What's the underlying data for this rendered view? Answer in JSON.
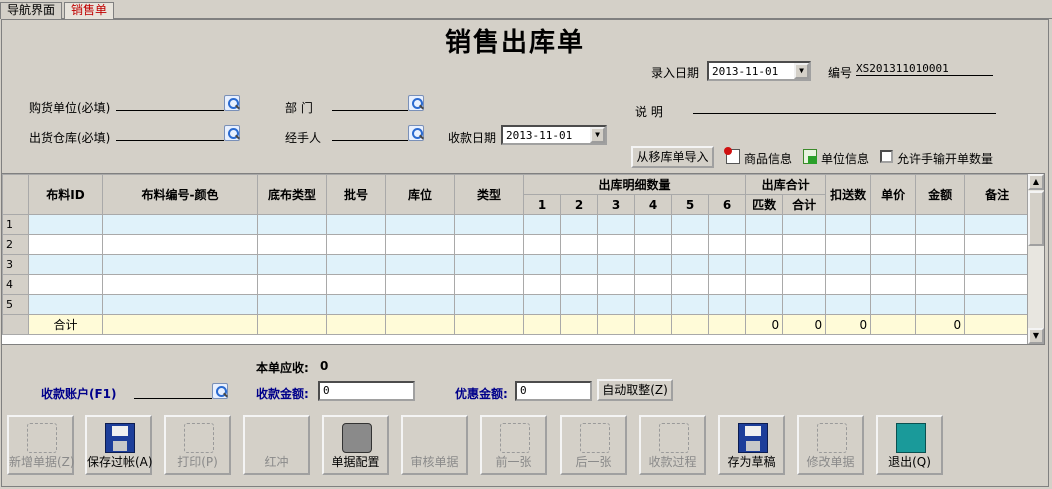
{
  "tabs": [
    {
      "label": "导航界面"
    },
    {
      "label": "销售单"
    }
  ],
  "title": "销售出库单",
  "header": {
    "entry_date_label": "录入日期",
    "entry_date_value": "2013-11-01",
    "number_label": "编号",
    "number_value": "XS201311010001",
    "buyer_label": "购货单位(必填)",
    "dept_label": "部  门",
    "remark_label": "说    明",
    "warehouse_label": "出货仓库(必填)",
    "handler_label": "经手人",
    "collect_date_label": "收款日期",
    "collect_date_value": "2013-11-01",
    "import_button": "从移库单导入",
    "goods_info": "商品信息",
    "unit_info": "单位信息",
    "allow_manual": "允许手输开单数量"
  },
  "grid": {
    "headers": {
      "fabric_id": "布料ID",
      "fabric_code": "布料编号-颜色",
      "base_type": "底布类型",
      "batch": "批号",
      "location": "库位",
      "type": "类型",
      "detail_group": "出库明细数量",
      "detail_cols": [
        "1",
        "2",
        "3",
        "4",
        "5",
        "6"
      ],
      "total_group": "出库合计",
      "pieces": "匹数",
      "total": "合计",
      "deduct": "扣送数",
      "price": "单价",
      "amount": "金额",
      "note": "备注"
    },
    "row_numbers": [
      "1",
      "2",
      "3",
      "4",
      "5"
    ],
    "sum_row": {
      "label": "合计",
      "pieces": "0",
      "total": "0",
      "deduct": "0",
      "amount": "0"
    }
  },
  "footer": {
    "receivable_label": "本单应收:",
    "receivable_value": "0",
    "account_label": "收款账户(F1)",
    "amount_label": "收款金额:",
    "amount_value": "0",
    "discount_label": "优惠金额:",
    "discount_value": "0",
    "auto_round": "自动取整(Z)"
  },
  "toolbar": [
    {
      "label": "新增单据(Z)",
      "icon": "new-document-icon",
      "enabled": false
    },
    {
      "label": "保存过帐(A)",
      "icon": "save-icon",
      "enabled": true
    },
    {
      "label": "打印(P)",
      "icon": "print-icon",
      "enabled": false
    },
    {
      "label": "红冲",
      "icon": "",
      "enabled": false
    },
    {
      "label": "单据配置",
      "icon": "config-icon",
      "enabled": true
    },
    {
      "label": "审核单据",
      "icon": "",
      "enabled": false
    },
    {
      "label": "前一张",
      "icon": "prev-hand-icon",
      "enabled": false
    },
    {
      "label": "后一张",
      "icon": "next-hand-icon",
      "enabled": false
    },
    {
      "label": "收款过程",
      "icon": "payment-process-icon",
      "enabled": false
    },
    {
      "label": "存为草稿",
      "icon": "save-draft-icon",
      "enabled": true
    },
    {
      "label": "修改单据",
      "icon": "edit-document-icon",
      "enabled": false
    },
    {
      "label": "退出(Q)",
      "icon": "exit-icon",
      "enabled": true
    }
  ]
}
